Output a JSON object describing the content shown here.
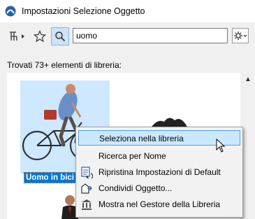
{
  "window": {
    "title": "Impostazioni Selezione Oggetto"
  },
  "toolbar": {
    "search_value": "uomo",
    "icons": [
      "hierarchy-icon",
      "star-icon",
      "search-icon",
      "gear-icon"
    ]
  },
  "results": {
    "found_text": "Trovati 73+ elementi di libreria:",
    "selected_item_label": "Uomo in bici"
  },
  "context_menu": {
    "items": [
      {
        "label": "Seleziona nella libreria",
        "highlighted": true
      },
      {
        "label": "Ricerca per Nome"
      },
      {
        "label": "Ripristina Impostazioni di Default",
        "icon": "reset-icon"
      },
      {
        "label": "Condividi Oggetto...",
        "icon": "share-object-icon"
      },
      {
        "label": "Mostra nel Gestore della Libreria",
        "icon": "library-manager-icon"
      }
    ]
  },
  "colors": {
    "selection": "#0078d7",
    "highlight": "#cce8ff",
    "thumb_selection": "#cde8ff"
  }
}
